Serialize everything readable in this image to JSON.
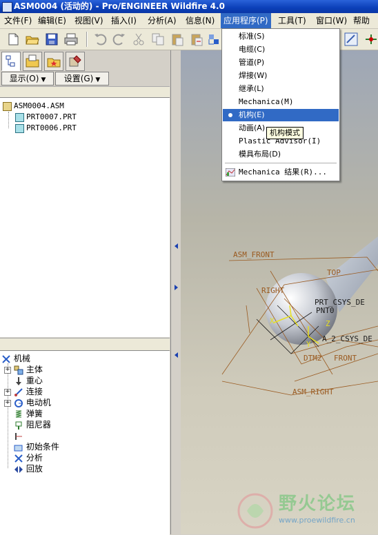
{
  "window": {
    "title": "ASM0004 (活动的) - Pro/ENGINEER Wildfire 4.0"
  },
  "menubar": {
    "items": [
      {
        "label": "文件(F)"
      },
      {
        "label": "编辑(E)"
      },
      {
        "label": "视图(V)"
      },
      {
        "label": "插入(I)"
      },
      {
        "label": "分析(A)"
      },
      {
        "label": "信息(N)"
      },
      {
        "label": "应用程序(P)"
      },
      {
        "label": "工具(T)"
      },
      {
        "label": "窗口(W)"
      },
      {
        "label": "帮助"
      }
    ]
  },
  "app_menu": {
    "items": [
      {
        "label": "标准(S)"
      },
      {
        "label": "电缆(C)"
      },
      {
        "label": "管道(P)"
      },
      {
        "label": "焊接(W)"
      },
      {
        "label": "继承(L)"
      },
      {
        "label": "Mechanica(M)"
      },
      {
        "label": "机构(E)"
      },
      {
        "label": "动画(A)"
      },
      {
        "label": "Plastic Advisor(I)"
      },
      {
        "label": "模具布局(D)"
      },
      {
        "label": "Mechanica 结果(R)..."
      }
    ],
    "tooltip": "机构模式"
  },
  "navigator": {
    "show_label": "显示(O)",
    "settings_label": "设置(G)"
  },
  "model_tree": {
    "items": [
      {
        "label": "ASM0004.ASM"
      },
      {
        "label": "PRT0007.PRT"
      },
      {
        "label": "PRT0006.PRT"
      }
    ]
  },
  "mech_tree": {
    "root": "机械",
    "items": [
      {
        "label": "主体"
      },
      {
        "label": "重心"
      },
      {
        "label": "连接"
      },
      {
        "label": "电动机"
      },
      {
        "label": "弹簧"
      },
      {
        "label": "阻尼器"
      },
      {
        "label": "初始条件"
      },
      {
        "label": "分析"
      },
      {
        "label": "回放"
      }
    ]
  },
  "graphics": {
    "datums": {
      "asm_front": "ASM_FRONT",
      "top": "TOP",
      "right": "RIGHT",
      "prt_csys": "PRT_CSYS_DE",
      "pnt0": "PNT0",
      "a2_csys": "A_2_CSYS_DE",
      "dtm2": "DTM2",
      "front": "FRONT",
      "asm_right": "ASM_RIGHT",
      "x": "X",
      "y": "Y",
      "z": "Z"
    }
  },
  "watermark": {
    "text": "野火论坛",
    "url": "www.proewildfire.cn"
  }
}
